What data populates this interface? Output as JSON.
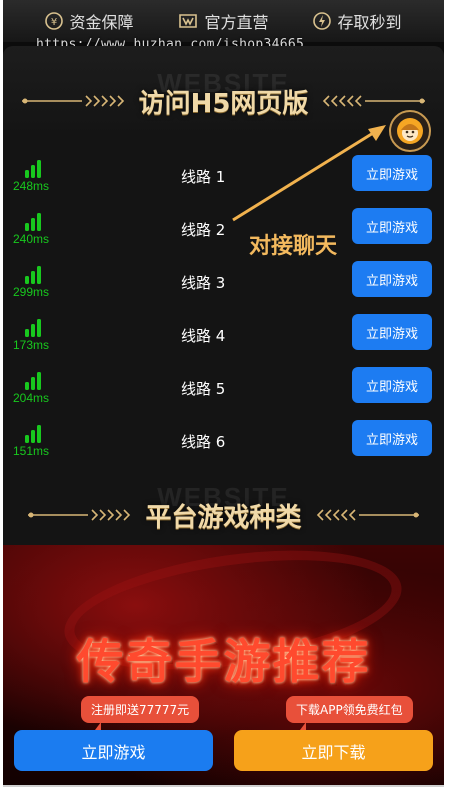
{
  "top_bar": {
    "items": [
      {
        "label": "资金保障",
        "icon": "yen-shield-icon"
      },
      {
        "label": "官方直营",
        "icon": "official-badge-icon"
      },
      {
        "label": "存取秒到",
        "icon": "lightning-icon"
      }
    ]
  },
  "watermark": "https://www.huzhan.com/ishop34665",
  "section1": {
    "ghost": "WEBSITE",
    "title": "访问H5网页版"
  },
  "chat": {
    "label": "对接聊天",
    "icon": "customer-service-icon"
  },
  "lines": [
    {
      "name": "线路 1",
      "ping": "248ms",
      "button": "立即游戏"
    },
    {
      "name": "线路 2",
      "ping": "240ms",
      "button": "立即游戏"
    },
    {
      "name": "线路 3",
      "ping": "299ms",
      "button": "立即游戏"
    },
    {
      "name": "线路 4",
      "ping": "173ms",
      "button": "立即游戏"
    },
    {
      "name": "线路 5",
      "ping": "204ms",
      "button": "立即游戏"
    },
    {
      "name": "线路 6",
      "ping": "151ms",
      "button": "立即游戏"
    }
  ],
  "section2": {
    "ghost": "WEBSITE",
    "title": "平台游戏种类"
  },
  "banner": {
    "title": "传奇手游推荐"
  },
  "promos": {
    "register": "注册即送77777元",
    "download": "下载APP领免费红包"
  },
  "cta": {
    "play": "立即游戏",
    "download": "立即下载"
  },
  "colors": {
    "primary_blue": "#1d7cf2",
    "signal_green": "#18c81e",
    "gold_title": "#f0d9a8",
    "promo_red": "#e8503a",
    "download_orange": "#f6a11a"
  }
}
